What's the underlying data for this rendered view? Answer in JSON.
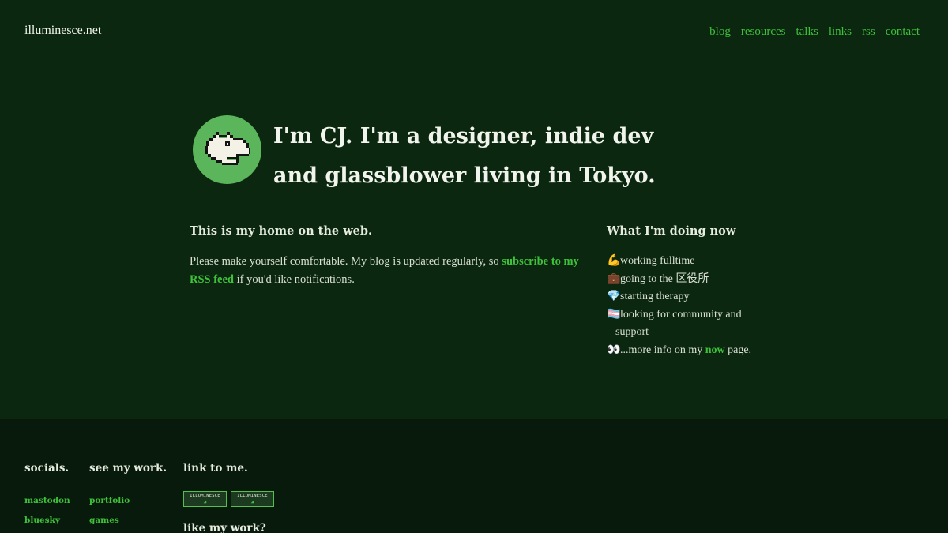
{
  "site": {
    "title": "illuminesce.net"
  },
  "nav": {
    "items": [
      "blog",
      "resources",
      "talks",
      "links",
      "rss",
      "contact"
    ]
  },
  "hero": {
    "avatar_icon": "pixel-creature-icon",
    "text": "I'm CJ. I'm a designer, indie dev and glassblower living in Tokyo."
  },
  "home": {
    "heading": "This is my home on the web.",
    "text_before": "Please make yourself comfortable. My blog is updated regularly, so ",
    "link_text": "subscribe to my RSS feed",
    "text_after": " if you'd like notifications."
  },
  "now": {
    "heading": "What I'm doing now",
    "items": [
      {
        "emoji": "💪",
        "text": "working fulltime"
      },
      {
        "emoji": "💼",
        "text": "going to the 区役所"
      },
      {
        "emoji": "💎",
        "text": "starting therapy"
      },
      {
        "emoji": "🏳️‍⚧️",
        "text": "looking for community and support"
      }
    ],
    "more": {
      "emoji": "👀",
      "before": "...more info on my ",
      "link": "now",
      "after": " page."
    }
  },
  "footer": {
    "socials": {
      "heading": "socials.",
      "links": [
        "mastodon",
        "bluesky"
      ]
    },
    "work": {
      "heading": "see my work.",
      "links": [
        "portfolio",
        "games"
      ]
    },
    "linkme": {
      "heading": "link to me.",
      "badges": [
        "ILLUMINESCE",
        "ILLUMINESCE"
      ],
      "subheading": "like my work?"
    }
  },
  "colors": {
    "background": "#0c2710",
    "footer": "#081a0b",
    "accent": "#3ec23a",
    "avatar": "#5bb55a"
  }
}
